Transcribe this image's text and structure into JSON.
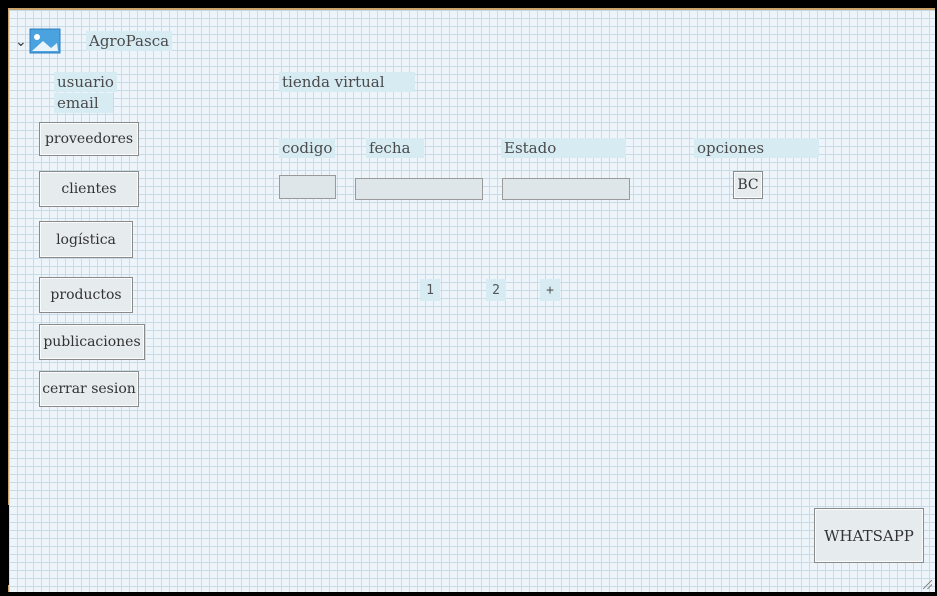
{
  "app": {
    "title": "AgroPasca"
  },
  "user": {
    "usuario_label": "usuario",
    "email_label": "email"
  },
  "sidebar": {
    "items": [
      {
        "label": "proveedores"
      },
      {
        "label": "clientes"
      },
      {
        "label": "logística"
      },
      {
        "label": "productos"
      },
      {
        "label": "publicaciones"
      },
      {
        "label": "cerrar sesion"
      }
    ]
  },
  "main": {
    "title": "tienda virtual",
    "headers": {
      "codigo": "codigo",
      "fecha": "fecha",
      "estado": "Estado",
      "opciones": "opciones"
    },
    "fields": {
      "codigo": "",
      "fecha": "",
      "estado": ""
    },
    "options_button": "BC",
    "pagination": [
      "1",
      "2",
      "+"
    ]
  },
  "footer": {
    "whatsapp_button": "WHATSAPP"
  },
  "icons": {
    "collapse": "chevron-down-icon",
    "logo": "image-icon"
  }
}
